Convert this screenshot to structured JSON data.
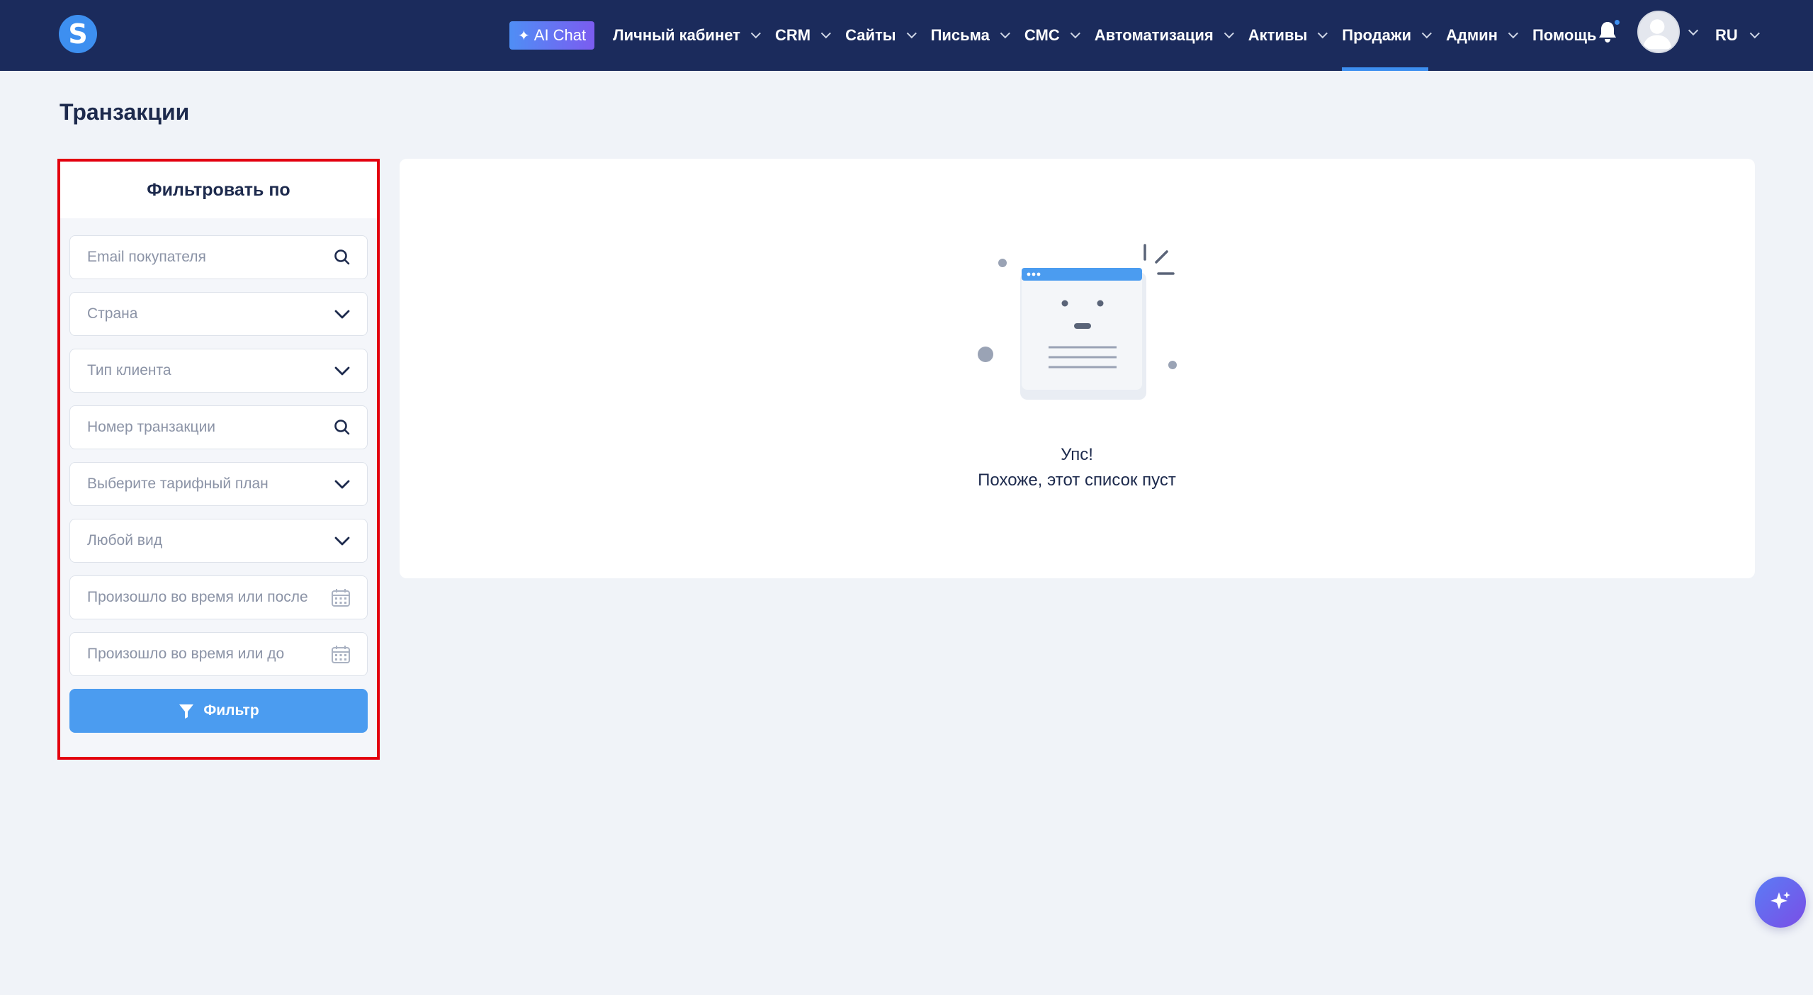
{
  "header": {
    "logo_letter": "S",
    "ai_chat_label": "AI Chat",
    "nav": [
      {
        "label": "Личный кабинет"
      },
      {
        "label": "CRM"
      },
      {
        "label": "Сайты"
      },
      {
        "label": "Письма"
      },
      {
        "label": "СМС"
      },
      {
        "label": "Автоматизация"
      },
      {
        "label": "Активы"
      },
      {
        "label": "Продажи",
        "active": true
      },
      {
        "label": "Админ"
      },
      {
        "label": "Помощь"
      }
    ],
    "language": "RU",
    "colors": {
      "bar": "#1b2b5c",
      "accent": "#3d8ff0"
    }
  },
  "page": {
    "title": "Транзакции"
  },
  "filter": {
    "title": "Фильтровать по",
    "fields": {
      "email_placeholder": "Email покупателя",
      "country_placeholder": "Страна",
      "client_type_placeholder": "Тип клиента",
      "transaction_number_placeholder": "Номер транзакции",
      "plan_placeholder": "Выберите тарифный план",
      "kind_placeholder": "Любой вид",
      "date_after_placeholder": "Произошло во время или после",
      "date_before_placeholder": "Произошло во время или до"
    },
    "button_label": "Фильтр",
    "highlight_color": "#e3000f"
  },
  "empty_state": {
    "title": "Упс!",
    "subtitle": "Похоже, этот список пуст"
  }
}
